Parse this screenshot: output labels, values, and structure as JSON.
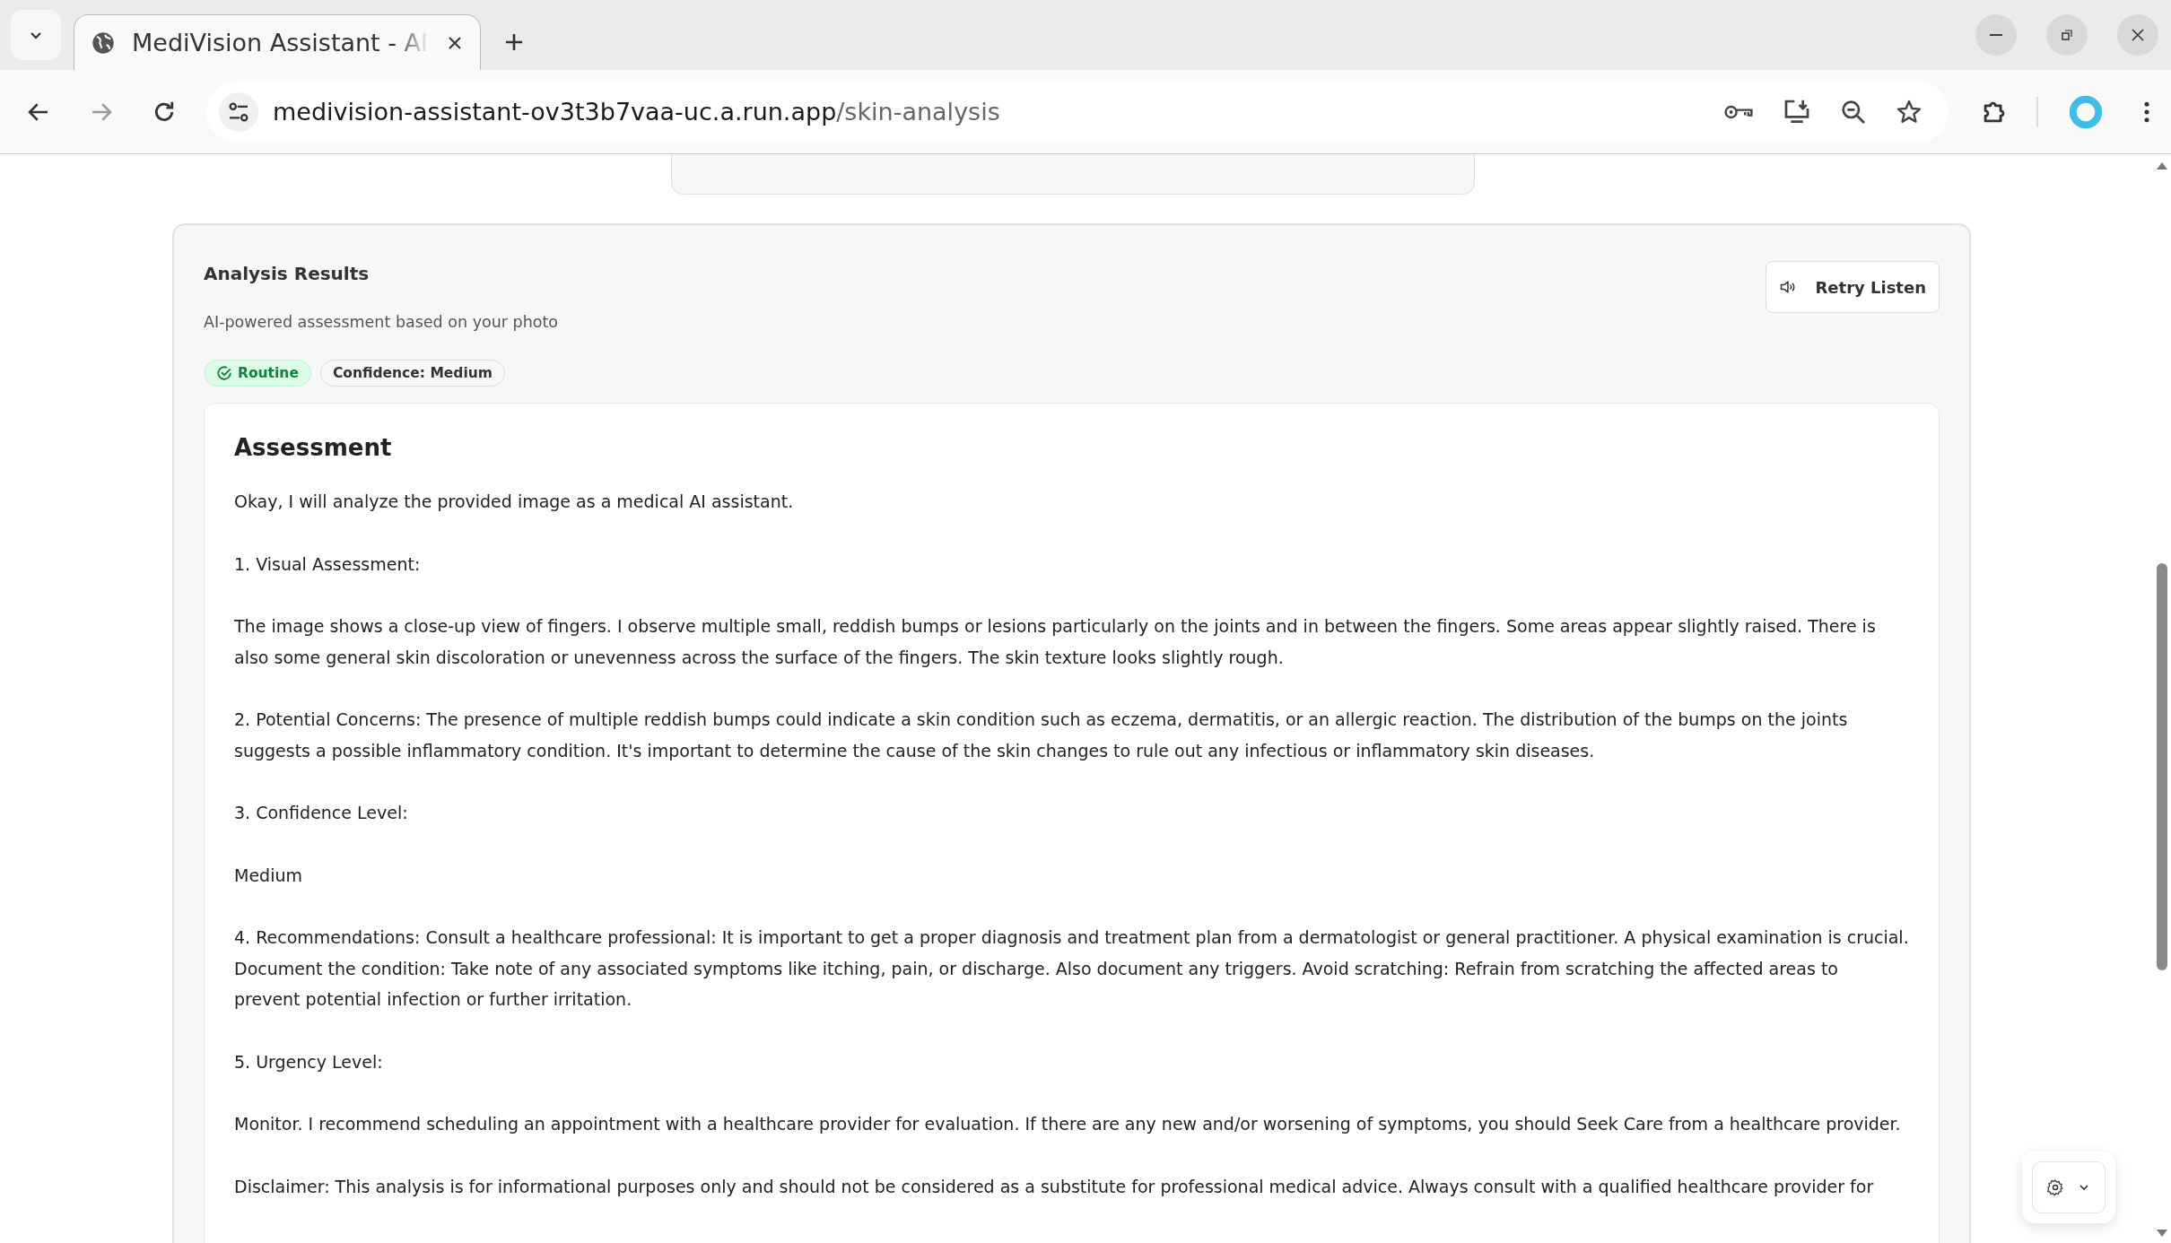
{
  "browser": {
    "tabs": [
      {
        "title": "MediVision Assistant - AI",
        "selected": true
      }
    ],
    "url": {
      "host": "medivision-assistant-ov3t3b7vaa-uc.a.run.app",
      "path": "/skin-analysis"
    }
  },
  "analysis": {
    "title": "Analysis Results",
    "subtitle": "AI-powered assessment based on your photo",
    "retry_button": "Retry Listen",
    "badges": [
      {
        "kind": "urgency",
        "label": "Routine"
      },
      {
        "kind": "confidence",
        "label": "Confidence: Medium"
      }
    ],
    "assessment": {
      "heading": "Assessment",
      "paragraphs": [
        "Okay, I will analyze the provided image as a medical AI assistant.",
        "1. Visual Assessment:",
        "The image shows a close-up view of fingers. I observe multiple small, reddish bumps or lesions particularly on the joints and in between the fingers. Some areas appear slightly raised. There is also some general skin discoloration or unevenness across the surface of the fingers. The skin texture looks slightly rough.",
        "2. Potential Concerns: The presence of multiple reddish bumps could indicate a skin condition such as eczema, dermatitis, or an allergic reaction. The distribution of the bumps on the joints suggests a possible inflammatory condition. It's important to determine the cause of the skin changes to rule out any infectious or inflammatory skin diseases.",
        "3. Confidence Level:",
        "Medium",
        "4. Recommendations: Consult a healthcare professional: It is important to get a proper diagnosis and treatment plan from a dermatologist or general practitioner. A physical examination is crucial. Document the condition: Take note of any associated symptoms like itching, pain, or discharge. Also document any triggers. Avoid scratching: Refrain from scratching the affected areas to prevent potential infection or further irritation.",
        "5. Urgency Level:",
        "Monitor. I recommend scheduling an appointment with a healthcare provider for evaluation. If there are any new and/or worsening of symptoms, you should Seek Care from a healthcare provider.",
        "Disclaimer: This analysis is for informational purposes only and should not be considered as a substitute for professional medical advice. Always consult with a qualified healthcare provider for"
      ]
    }
  }
}
